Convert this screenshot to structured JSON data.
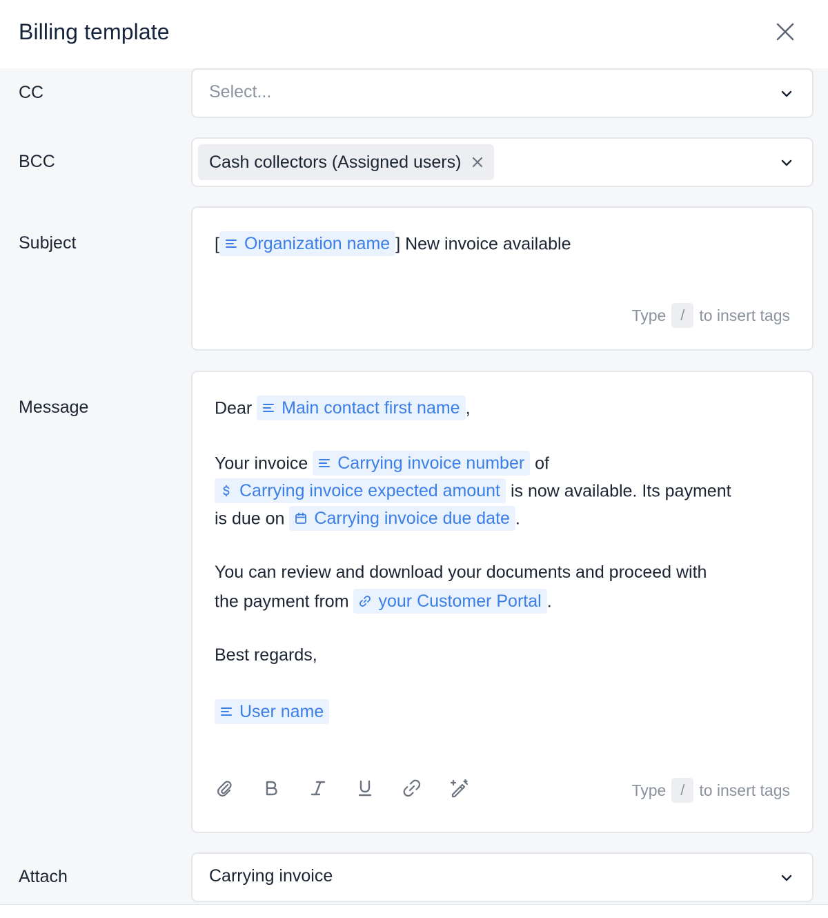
{
  "header": {
    "title": "Billing template"
  },
  "fields": {
    "cc": {
      "label": "CC",
      "placeholder": "Select..."
    },
    "bcc": {
      "label": "BCC",
      "chip": "Cash collectors (Assigned users)"
    },
    "subject": {
      "label": "Subject",
      "open_bracket": "[",
      "tag": "Organization name",
      "close_bracket": "]",
      "text": "New invoice available"
    },
    "message": {
      "label": "Message",
      "dear": "Dear",
      "tag_first_name": "Main contact first name",
      "comma": ",",
      "your_invoice": "Your invoice",
      "tag_invoice_number": "Carrying invoice number",
      "of": "of",
      "tag_expected_amount": "Carrying invoice expected amount",
      "now_available": "is now available. Its payment",
      "due_on": "is due on",
      "tag_due_date": "Carrying invoice due date",
      "period": ".",
      "review_line": "You can review and download your documents and proceed with",
      "payment_from": "the payment from",
      "tag_portal": "your Customer Portal",
      "period2": ".",
      "regards": "Best regards,",
      "tag_user_name": "User name"
    },
    "attach": {
      "label": "Attach",
      "value": "Carrying invoice"
    }
  },
  "hint": {
    "before": "Type",
    "key": "/",
    "after": "to insert tags"
  },
  "toolbar": {
    "icons": [
      "paperclip-icon",
      "bold-icon",
      "italic-icon",
      "underline-icon",
      "link-icon",
      "magic-wand-icon"
    ]
  },
  "colors": {
    "tag_bg": "#eaf2fd",
    "tag_text": "#3a7ee8",
    "border": "#e3e6eb"
  }
}
